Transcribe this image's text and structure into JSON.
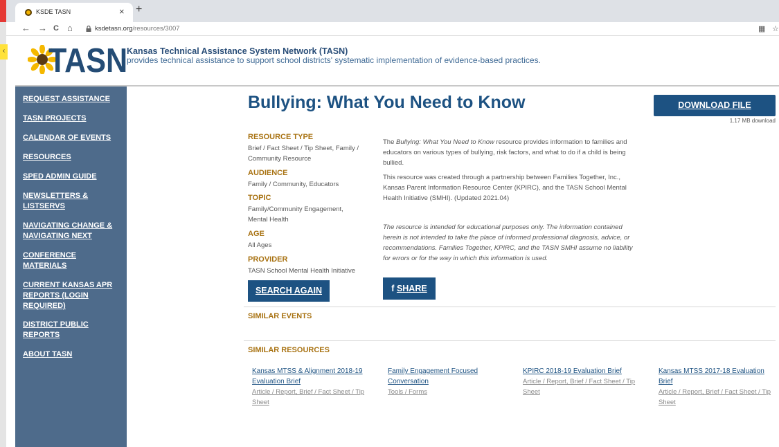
{
  "browser": {
    "tab_title": "KSDE TASN",
    "tab_close": "×",
    "new_tab": "+",
    "url_domain": "ksdetasn.org",
    "url_path": "/resources/3007",
    "nav_back": "←",
    "nav_forward": "→",
    "nav_reload": "C",
    "nav_home": "⌂",
    "lock": "🔒",
    "side_handle": "‹"
  },
  "header": {
    "logo_text": "TASN",
    "org_title": "Kansas Technical Assistance System Network (TASN)",
    "org_tagline": "provides technical assistance to support school districts' systematic implementation of evidence-based practices."
  },
  "sidebar": {
    "items": [
      {
        "label": "REQUEST ASSISTANCE"
      },
      {
        "label": "TASN PROJECTS"
      },
      {
        "label": "CALENDAR OF EVENTS"
      },
      {
        "label": "RESOURCES"
      },
      {
        "label": "SPED ADMIN GUIDE"
      },
      {
        "label": "NEWSLETTERS & LISTSERVS"
      },
      {
        "label": "NAVIGATING CHANGE & NAVIGATING NEXT"
      },
      {
        "label": "CONFERENCE MATERIALS"
      },
      {
        "label": "CURRENT KANSAS APR REPORTS (LOGIN REQUIRED)"
      },
      {
        "label": "DISTRICT PUBLIC REPORTS"
      },
      {
        "label": "ABOUT TASN"
      }
    ]
  },
  "resource": {
    "title": "Bullying: What You Need to Know",
    "download_label": "DOWNLOAD FILE",
    "download_size": "1.17 MB download",
    "meta": {
      "type_h": "RESOURCE TYPE",
      "type_v": "Brief / Fact Sheet / Tip Sheet, Family / Community Resource",
      "audience_h": "AUDIENCE",
      "audience_v": "Family / Community, Educators",
      "topic_h": "TOPIC",
      "topic_v": "Family/Community Engagement, Mental Health",
      "age_h": "AGE",
      "age_v": "All Ages",
      "provider_h": "PROVIDER",
      "provider_v": "TASN School Mental Health Initiative"
    },
    "desc1_pre": "The ",
    "desc1_em": "Bullying: What You Need to Know",
    "desc1_post": " resource provides information to families and educators on various types of bullying, risk factors, and what to do if a child is being bullied.",
    "desc2": "This resource was created through a partnership between Families Together, Inc., Kansas Parent Information Resource Center (KPIRC), and the TASN School Mental Health Initiative (SMHI). (Updated 2021.04)",
    "disclaimer": "The resource is intended for educational purposes only. The information contained herein is not intended to take the place of informed professional diagnosis, advice, or recommendations. Families Together, KPIRC, and the TASN SMHI assume no liability for errors or for the way in which this information is used.",
    "search_again": "SEARCH AGAIN",
    "share_icon": "f",
    "share_label": "SHARE"
  },
  "similar_events": {
    "heading": "SIMILAR EVENTS"
  },
  "similar_resources": {
    "heading": "SIMILAR RESOURCES",
    "items": [
      {
        "title": "Kansas MTSS & Alignment 2018-19 Evaluation Brief",
        "sub": "Article / Report, Brief / Fact Sheet / Tip Sheet"
      },
      {
        "title": "Family Engagement Focused Conversation",
        "sub": "Tools / Forms"
      },
      {
        "title": "KPIRC 2018-19 Evaluation Brief",
        "sub": "Article / Report, Brief / Fact Sheet / Tip Sheet"
      },
      {
        "title": "Kansas MTSS 2017-18 Evaluation Brief",
        "sub": "Article / Report, Brief / Fact Sheet / Tip Sheet"
      }
    ]
  },
  "colors": {
    "brand_blue": "#1d5282",
    "sidebar_bg": "#4e6b8b",
    "heading_gold": "#a87212"
  }
}
